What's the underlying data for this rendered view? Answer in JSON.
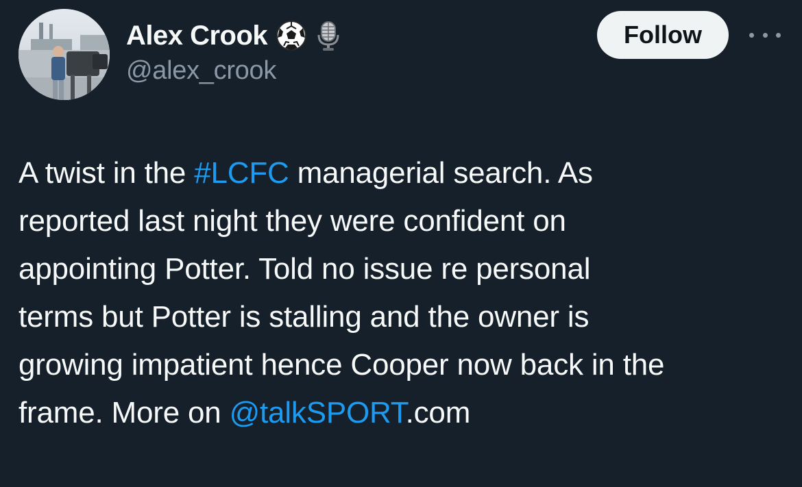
{
  "author": {
    "display_name": "Alex Crook",
    "handle": "@alex_crook",
    "badges": [
      "soccer-ball-icon",
      "studio-microphone-icon"
    ]
  },
  "actions": {
    "follow_label": "Follow",
    "more_icon": "more-horizontal-icon"
  },
  "tweet": {
    "lines": [
      {
        "parts": [
          {
            "text": "A twist in the ",
            "type": "text"
          },
          {
            "text": "#LCFC",
            "type": "hashtag"
          },
          {
            "text": " managerial search. As",
            "type": "text"
          }
        ]
      },
      {
        "parts": [
          {
            "text": "reported last night they were confident on",
            "type": "text"
          }
        ]
      },
      {
        "parts": [
          {
            "text": "appointing Potter. Told no issue re personal",
            "type": "text"
          }
        ]
      },
      {
        "parts": [
          {
            "text": "terms but Potter is stalling and the owner is",
            "type": "text"
          }
        ]
      },
      {
        "parts": [
          {
            "text": "growing impatient hence Cooper now back in the",
            "type": "text"
          }
        ]
      },
      {
        "parts": [
          {
            "text": "frame. More on ",
            "type": "text"
          },
          {
            "text": "@talkSPORT",
            "type": "mention"
          },
          {
            "text": ".com",
            "type": "text"
          }
        ]
      }
    ]
  },
  "colors": {
    "background": "#15202b",
    "text": "#f7f9f9",
    "secondary_text": "#8b98a5",
    "link": "#1d9bf0",
    "follow_button_bg": "#eff3f4",
    "follow_button_text": "#0f1419"
  }
}
